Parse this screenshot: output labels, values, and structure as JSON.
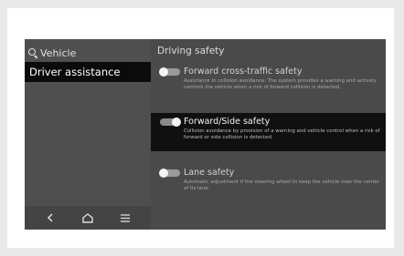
{
  "sidebar": {
    "header_label": "Vehicle",
    "active_item": "Driver assistance",
    "nav": {
      "back_glyph": "<",
      "home_icon": "home-icon",
      "menu_glyph": "≡"
    }
  },
  "main": {
    "title": "Driving safety",
    "options": [
      {
        "title": "Forward cross-traffic safety",
        "description": "Assistance in collision avoidance. The system provides a warning and actively controls the vehicle when a risk of forward collision is detected.",
        "enabled": false
      },
      {
        "title": "Forward/Side safety",
        "description": "Collision avoidance by provision of a warning and vehicle control when a risk of forward or side collision is detected.",
        "enabled": true
      },
      {
        "title": "Lane safety",
        "description": "Automatic adjustment if the steering wheel to keep the vehicle near the center of its lane.",
        "enabled": false
      }
    ]
  },
  "colors": {
    "screen_bg": "#4a4a4a",
    "active_bg": "#0b0b0b",
    "toggle_knob": "#f4f4f4"
  }
}
